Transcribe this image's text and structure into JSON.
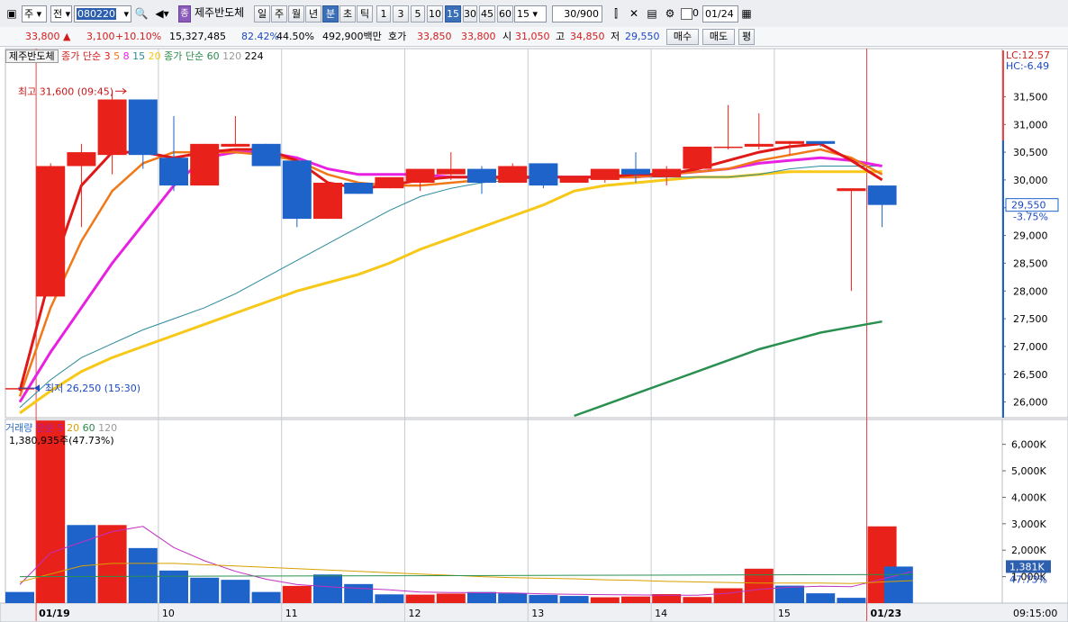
{
  "toolbar": {
    "period_prefix": "주",
    "prev_label": "전",
    "code": "080220",
    "stock_name": "제주반도체",
    "stock_badge": "종",
    "periods": [
      "일",
      "주",
      "월",
      "년",
      "분",
      "초",
      "틱"
    ],
    "selected_period": "분",
    "intervals": [
      "1",
      "3",
      "5",
      "10",
      "15",
      "30",
      "45",
      "60"
    ],
    "selected_interval": "15",
    "interval_value": "15",
    "count": "30/900",
    "checkbox_label": "0",
    "date": "01/24"
  },
  "quote": {
    "price": "33,800",
    "change": "3,100",
    "change_pct": "+10.10%",
    "volume": "15,327,485",
    "vol_ratio": "82.42%",
    "turnover": "44.50%",
    "amount": "492,900백만",
    "hoga_label": "호가",
    "ask": "33,850",
    "bid": "33,800",
    "open_label": "시",
    "open": "31,050",
    "high_label": "고",
    "high": "34,850",
    "low_label": "저",
    "low": "29,550",
    "buy_label": "매수",
    "sell_label": "매도",
    "flat_label": "평"
  },
  "price_panel": {
    "name_label": "제주반도체",
    "ma1_label": "종가 단순",
    "ma1_periods": [
      "3",
      "5",
      "8",
      "15",
      "20"
    ],
    "ma2_label": "종가 단순",
    "ma2_periods": [
      "60",
      "120",
      "224"
    ],
    "lc_label": "LC:12.57",
    "hc_label": "HC:-6.49",
    "high_marker": "최고 31,600 (09:45)",
    "low_marker": "최저 26,250 (15:30)",
    "current_price": "29,550",
    "current_change": "-3.75%",
    "y_ticks": [
      "31,500",
      "31,000",
      "30,500",
      "30,000",
      "29,500",
      "29,000",
      "28,500",
      "28,000",
      "27,500",
      "27,000",
      "26,500",
      "26,000"
    ]
  },
  "volume_panel": {
    "title": "거래량",
    "ma_label": "단순",
    "ma_periods": [
      "5",
      "20",
      "60",
      "120"
    ],
    "info": "1,380,935주(47.73%)",
    "current_volume": "1,381K",
    "current_pct": "47.73%",
    "y_ticks": [
      "6,000K",
      "5,000K",
      "4,000K",
      "3,000K",
      "2,000K",
      "1,000K"
    ]
  },
  "x_axis": {
    "labels": [
      "01/19",
      "10",
      "11",
      "12",
      "13",
      "14",
      "15",
      "01/23"
    ],
    "time": "09:15:00"
  },
  "colors": {
    "up": "#e8221a",
    "down": "#1d63c9",
    "ma3": "#e01818",
    "ma5": "#f07818",
    "ma8": "#e820e0",
    "ma15": "#2a8a9c",
    "ma20": "#f8c818",
    "ma60": "#2a9050"
  },
  "chart_data": {
    "type": "candlestick",
    "unit": "KRW",
    "ylim": [
      25750,
      31750
    ],
    "candles": [
      {
        "o": 26250,
        "h": 26250,
        "l": 26250,
        "c": 26250
      },
      {
        "o": 27900,
        "h": 30300,
        "l": 27900,
        "c": 30250
      },
      {
        "o": 30250,
        "h": 30650,
        "l": 29150,
        "c": 30500
      },
      {
        "o": 30450,
        "h": 31600,
        "l": 30100,
        "c": 31450
      },
      {
        "o": 31450,
        "h": 31450,
        "l": 30200,
        "c": 30450
      },
      {
        "o": 30400,
        "h": 31150,
        "l": 29800,
        "c": 29900
      },
      {
        "o": 29900,
        "h": 30650,
        "l": 29900,
        "c": 30650
      },
      {
        "o": 30600,
        "h": 31150,
        "l": 30600,
        "c": 30650
      },
      {
        "o": 30650,
        "h": 30650,
        "l": 30250,
        "c": 30250
      },
      {
        "o": 30350,
        "h": 30350,
        "l": 29150,
        "c": 29300
      },
      {
        "o": 29300,
        "h": 29950,
        "l": 29300,
        "c": 29950
      },
      {
        "o": 29950,
        "h": 29950,
        "l": 29750,
        "c": 29750
      },
      {
        "o": 29850,
        "h": 30000,
        "l": 29850,
        "c": 30050
      },
      {
        "o": 29950,
        "h": 30150,
        "l": 29800,
        "c": 30200
      },
      {
        "o": 30100,
        "h": 30500,
        "l": 30000,
        "c": 30200
      },
      {
        "o": 30200,
        "h": 30250,
        "l": 29750,
        "c": 29950
      },
      {
        "o": 29950,
        "h": 30300,
        "l": 29950,
        "c": 30250
      },
      {
        "o": 30300,
        "h": 30300,
        "l": 29850,
        "c": 29900
      },
      {
        "o": 29950,
        "h": 30000,
        "l": 29950,
        "c": 30050
      },
      {
        "o": 30000,
        "h": 30150,
        "l": 29950,
        "c": 30200
      },
      {
        "o": 30200,
        "h": 30500,
        "l": 29950,
        "c": 30100
      },
      {
        "o": 30050,
        "h": 30250,
        "l": 29900,
        "c": 30200
      },
      {
        "o": 30200,
        "h": 30600,
        "l": 30200,
        "c": 30600
      },
      {
        "o": 30600,
        "h": 31350,
        "l": 30550,
        "c": 30600
      },
      {
        "o": 30600,
        "h": 31200,
        "l": 30550,
        "c": 30650
      },
      {
        "o": 30650,
        "h": 30700,
        "l": 30450,
        "c": 30700
      },
      {
        "o": 30700,
        "h": 30650,
        "l": 30600,
        "c": 30650
      },
      {
        "o": 29800,
        "h": 29800,
        "l": 28000,
        "c": 29850
      },
      {
        "o": 29900,
        "h": 29900,
        "l": 29150,
        "c": 29550
      }
    ],
    "volumes": [
      420,
      6900,
      2950,
      2950,
      2080,
      1230,
      960,
      880,
      420,
      650,
      1080,
      720,
      330,
      320,
      360,
      420,
      370,
      310,
      270,
      220,
      250,
      340,
      230,
      560,
      1300,
      660,
      370,
      200,
      2900,
      1381
    ],
    "volume_ylim": [
      0,
      6600
    ],
    "ma": {
      "ma3": [
        26200,
        28300,
        29900,
        30500,
        30500,
        30400,
        30500,
        30550,
        30550,
        30350,
        29950,
        29850,
        29900,
        30000,
        30050,
        30050,
        30050,
        30050,
        30050,
        30050,
        30100,
        30100,
        30200,
        30350,
        30500,
        30600,
        30650,
        30350,
        30000
      ],
      "ma5": [
        26100,
        27700,
        28900,
        29800,
        30300,
        30500,
        30500,
        30500,
        30450,
        30350,
        30100,
        29950,
        29900,
        29900,
        29950,
        30000,
        30050,
        30050,
        30050,
        30050,
        30050,
        30100,
        30150,
        30200,
        30350,
        30450,
        30550,
        30400,
        30100
      ],
      "ma8": [
        26000,
        26900,
        27700,
        28500,
        29200,
        29900,
        30400,
        30500,
        30500,
        30400,
        30200,
        30100,
        30100,
        30100,
        30050,
        30050,
        30050,
        30050,
        30050,
        30050,
        30050,
        30100,
        30150,
        30200,
        30300,
        30350,
        30400,
        30350,
        30250
      ],
      "ma15": [
        25900,
        26400,
        26800,
        27050,
        27300,
        27500,
        27700,
        27950,
        28250,
        28550,
        28850,
        29150,
        29450,
        29700,
        29850,
        29950,
        30000,
        30050,
        30050,
        30050,
        30050,
        30050,
        30050,
        30050,
        30100,
        30200,
        30250,
        30250,
        30250
      ],
      "ma20": [
        25800,
        26200,
        26550,
        26800,
        27000,
        27200,
        27400,
        27600,
        27800,
        28000,
        28150,
        28300,
        28500,
        28750,
        28950,
        29150,
        29350,
        29550,
        29800,
        29900,
        29950,
        30000,
        30050,
        30050,
        30100,
        30150,
        30150,
        30150,
        30150
      ],
      "ma60": [
        null,
        null,
        null,
        null,
        null,
        null,
        null,
        null,
        null,
        null,
        null,
        null,
        null,
        null,
        null,
        null,
        null,
        null,
        25750,
        25950,
        26150,
        26350,
        26550,
        26750,
        26950,
        27100,
        27250,
        27350,
        27450
      ]
    }
  }
}
